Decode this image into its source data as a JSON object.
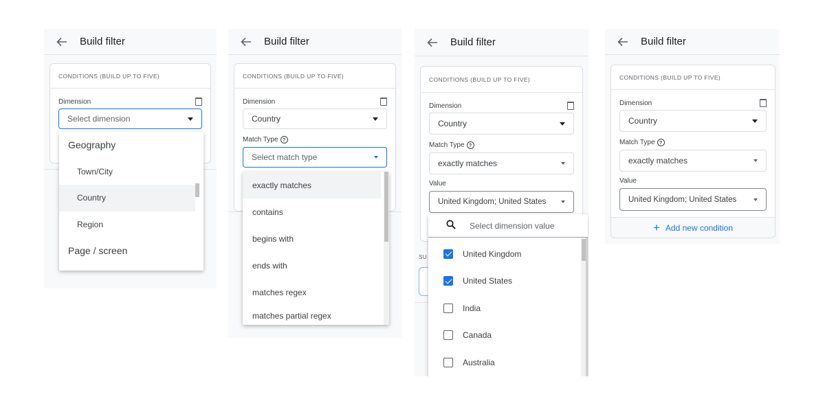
{
  "common": {
    "header_title": "Build filter",
    "conditions_heading": "CONDITIONS (BUILD UP TO FIVE)",
    "dimension_label": "Dimension",
    "match_type_label": "Match Type",
    "value_label": "Value",
    "help_glyph": "?",
    "icons": {
      "back": "arrow-back-icon",
      "delete": "trash-icon",
      "dropdown": "caret-down-icon",
      "help": "help-circle-icon",
      "search": "search-icon",
      "add": "plus-icon"
    }
  },
  "panel1": {
    "dimension_placeholder": "Select dimension",
    "dropdown": {
      "groups": [
        {
          "label": "Geography",
          "items": [
            "Town/City",
            "Country",
            "Region"
          ]
        },
        {
          "label": "Page / screen",
          "items": []
        }
      ],
      "highlighted": "Country"
    }
  },
  "panel2": {
    "dimension_value": "Country",
    "match_type_placeholder": "Select match type",
    "options": [
      "exactly matches",
      "contains",
      "begins with",
      "ends with",
      "matches regex",
      "matches partial regex"
    ],
    "highlighted": "exactly matches"
  },
  "panel3": {
    "dimension_value": "Country",
    "match_type_value": "exactly matches",
    "value_value": "United Kingdom; United States",
    "search_placeholder": "Select dimension value",
    "values": [
      {
        "label": "United Kingdom",
        "checked": true
      },
      {
        "label": "United States",
        "checked": true
      },
      {
        "label": "India",
        "checked": false
      },
      {
        "label": "Canada",
        "checked": false
      },
      {
        "label": "Australia",
        "checked": false
      }
    ],
    "partial_label": "SU"
  },
  "panel4": {
    "dimension_value": "Country",
    "match_type_value": "exactly matches",
    "value_value": "United Kingdom; United States",
    "add_condition_label": "Add new condition",
    "add_glyph": "+"
  },
  "colors": {
    "accent": "#1a73e8",
    "panel_bg": "#f8f9fa",
    "border": "#dadce0",
    "text": "#3c4043"
  }
}
